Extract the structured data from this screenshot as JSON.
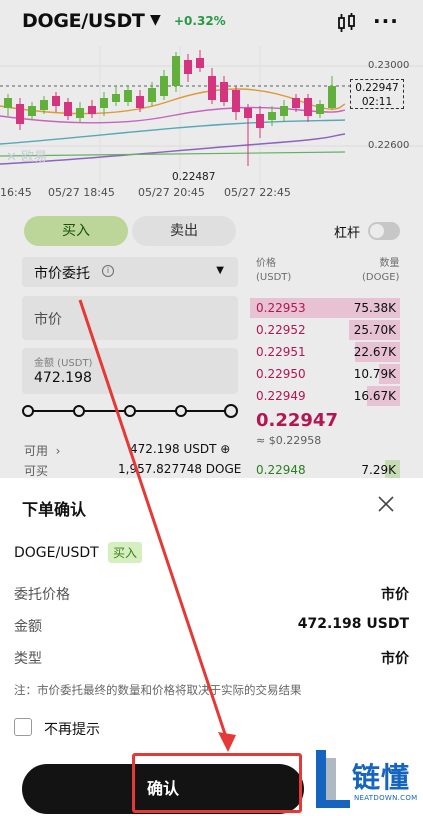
{
  "header": {
    "pair": "DOGE/USDT",
    "change": "+0.32%"
  },
  "chart": {
    "x_labels": [
      "16:45",
      "05/27 18:45",
      "05/27 20:45",
      "05/27 22:45"
    ],
    "y_labels": [
      "0.23000",
      "0.22600"
    ],
    "last_price": "0.22947",
    "countdown": "02:11",
    "low_price": "0.22487",
    "colors": {
      "up": "#6abf40",
      "down": "#e8398a"
    }
  },
  "trade": {
    "buy_label": "买入",
    "sell_label": "卖出",
    "leverage_label": "杠杆",
    "order_type": "市价委托",
    "price_placeholder": "市价",
    "amount_label": "金额 (USDT)",
    "amount_value": "472.198",
    "slider_percent": 100,
    "available_label": "可用",
    "available_value": "472.198 USDT",
    "can_buy_label": "可买",
    "can_buy_value": "1,957.827748 DOGE"
  },
  "orderbook": {
    "price_header": "价格",
    "price_unit": "(USDT)",
    "qty_header": "数量",
    "qty_unit": "(DOGE)",
    "asks": [
      {
        "price": "0.22953",
        "qty": "75.38K",
        "depth": 1.0
      },
      {
        "price": "0.22952",
        "qty": "25.70K",
        "depth": 0.34
      },
      {
        "price": "0.22951",
        "qty": "22.67K",
        "depth": 0.3
      },
      {
        "price": "0.22950",
        "qty": "10.79K",
        "depth": 0.14
      },
      {
        "price": "0.22949",
        "qty": "16.67K",
        "depth": 0.22
      }
    ],
    "last": "0.22947",
    "last_fiat": "≈ $0.22958",
    "bids": [
      {
        "price": "0.22948",
        "qty": "7.29K",
        "depth": 0.1
      }
    ]
  },
  "modal": {
    "title": "下单确认",
    "pair": "DOGE/USDT",
    "side_badge": "买入",
    "rows": [
      {
        "label": "委托价格",
        "value": "市价"
      },
      {
        "label": "金额",
        "value": "472.198 USDT"
      },
      {
        "label": "类型",
        "value": "市价"
      }
    ],
    "note": "注：市价委托最终的数量和价格将取决于实际的交易结果",
    "dont_show_label": "不再提示",
    "confirm_label": "确认"
  },
  "watermark": {
    "brand": "链懂",
    "domain": "NEATDOWN.COM"
  }
}
